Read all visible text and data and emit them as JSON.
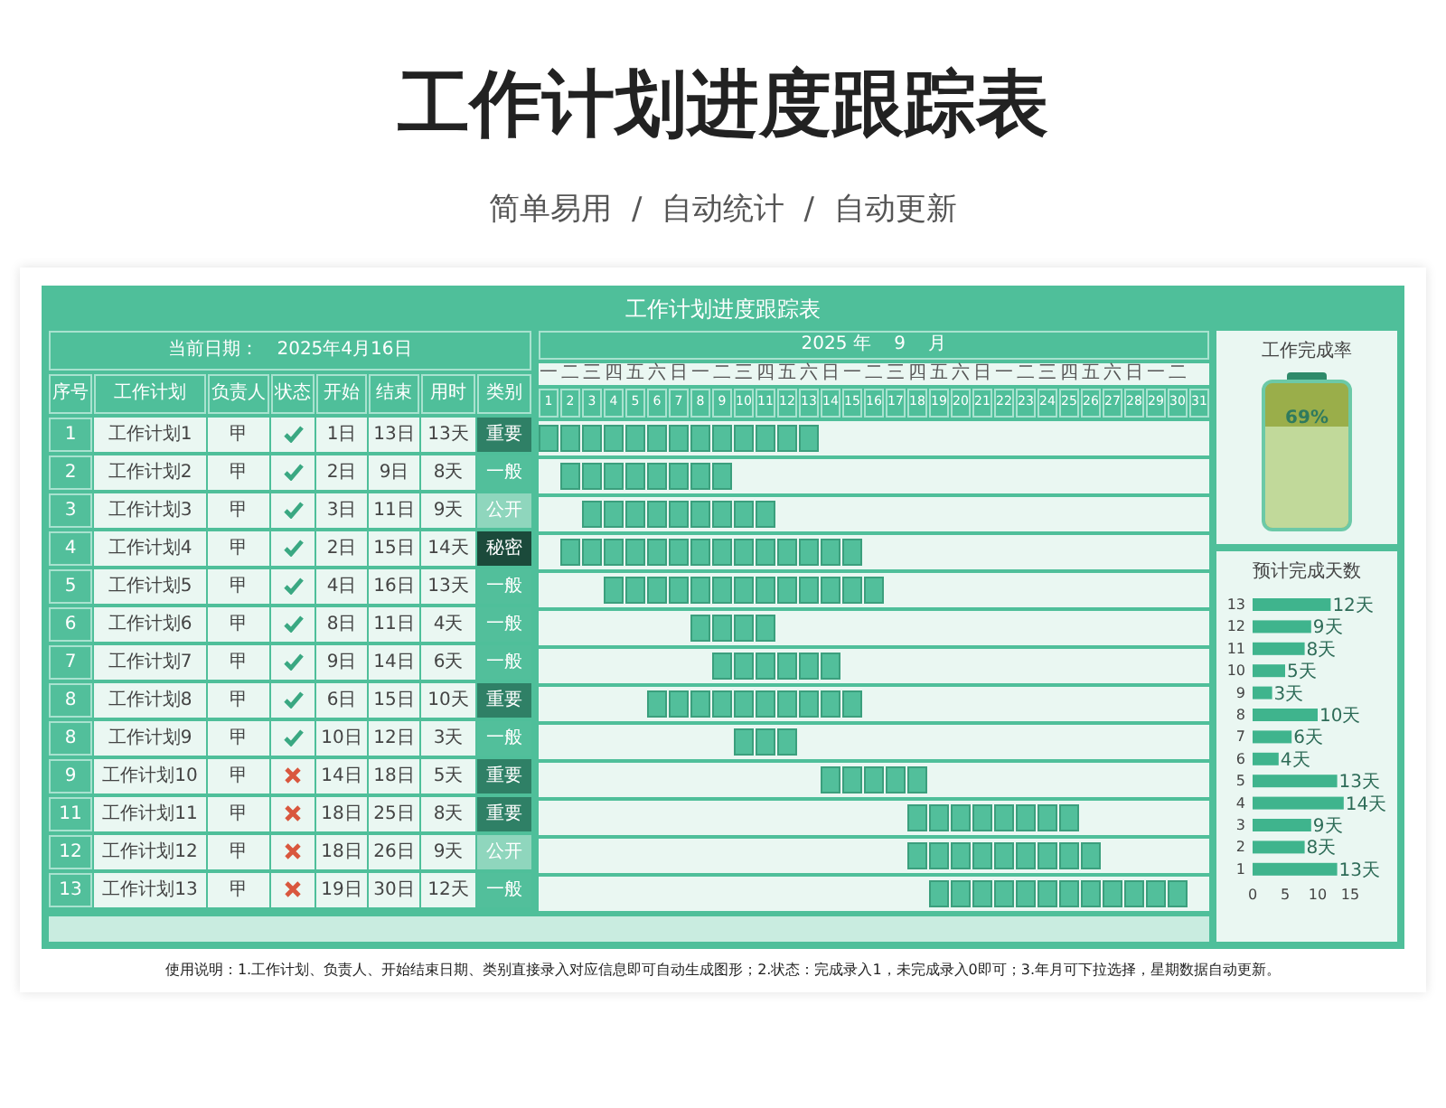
{
  "title": "工作计划进度跟踪表",
  "subtitle": "简单易用  /  自动统计  /  自动更新",
  "sheet": {
    "title": "工作计划进度跟踪表",
    "date_label": "当前日期：",
    "date_value": "2025年4月16日",
    "columns": [
      "序号",
      "工作计划",
      "负责人",
      "状态",
      "开始",
      "结束",
      "用时",
      "类别"
    ],
    "rows": [
      {
        "no": "1",
        "plan": "工作计划1",
        "owner": "甲",
        "done": true,
        "start": "1日",
        "end": "13日",
        "days": "13天",
        "category": "重要",
        "color": "#2f8066"
      },
      {
        "no": "2",
        "plan": "工作计划2",
        "owner": "甲",
        "done": true,
        "start": "2日",
        "end": "9日",
        "days": "8天",
        "category": "一般",
        "color": "#52bf9b"
      },
      {
        "no": "3",
        "plan": "工作计划3",
        "owner": "甲",
        "done": true,
        "start": "3日",
        "end": "11日",
        "days": "9天",
        "category": "公开",
        "color": "#8fd6bd"
      },
      {
        "no": "4",
        "plan": "工作计划4",
        "owner": "甲",
        "done": true,
        "start": "2日",
        "end": "15日",
        "days": "14天",
        "category": "秘密",
        "color": "#1b4a3b"
      },
      {
        "no": "5",
        "plan": "工作计划5",
        "owner": "甲",
        "done": true,
        "start": "4日",
        "end": "16日",
        "days": "13天",
        "category": "一般",
        "color": "#52bf9b"
      },
      {
        "no": "6",
        "plan": "工作计划6",
        "owner": "甲",
        "done": true,
        "start": "8日",
        "end": "11日",
        "days": "4天",
        "category": "一般",
        "color": "#52bf9b"
      },
      {
        "no": "7",
        "plan": "工作计划7",
        "owner": "甲",
        "done": true,
        "start": "9日",
        "end": "14日",
        "days": "6天",
        "category": "一般",
        "color": "#52bf9b"
      },
      {
        "no": "8",
        "plan": "工作计划8",
        "owner": "甲",
        "done": true,
        "start": "6日",
        "end": "15日",
        "days": "10天",
        "category": "重要",
        "color": "#2f8066"
      },
      {
        "no": "8",
        "plan": "工作计划9",
        "owner": "甲",
        "done": true,
        "start": "10日",
        "end": "12日",
        "days": "3天",
        "category": "一般",
        "color": "#52bf9b"
      },
      {
        "no": "9",
        "plan": "工作计划10",
        "owner": "甲",
        "done": false,
        "start": "14日",
        "end": "18日",
        "days": "5天",
        "category": "重要",
        "color": "#2f8066"
      },
      {
        "no": "11",
        "plan": "工作计划11",
        "owner": "甲",
        "done": false,
        "start": "18日",
        "end": "25日",
        "days": "8天",
        "category": "重要",
        "color": "#2f8066"
      },
      {
        "no": "12",
        "plan": "工作计划12",
        "owner": "甲",
        "done": false,
        "start": "18日",
        "end": "26日",
        "days": "9天",
        "category": "公开",
        "color": "#8fd6bd"
      },
      {
        "no": "13",
        "plan": "工作计划13",
        "owner": "甲",
        "done": false,
        "start": "19日",
        "end": "30日",
        "days": "12天",
        "category": "一般",
        "color": "#52bf9b"
      }
    ],
    "month_title": "2025 年    9    月",
    "calendar": [
      {
        "day": "1",
        "weekday": "一"
      },
      {
        "day": "2",
        "weekday": "二"
      },
      {
        "day": "3",
        "weekday": "三"
      },
      {
        "day": "4",
        "weekday": "四"
      },
      {
        "day": "5",
        "weekday": "五"
      },
      {
        "day": "6",
        "weekday": "六"
      },
      {
        "day": "7",
        "weekday": "日"
      },
      {
        "day": "8",
        "weekday": "一"
      },
      {
        "day": "9",
        "weekday": "二"
      },
      {
        "day": "10",
        "weekday": "三"
      },
      {
        "day": "11",
        "weekday": "四"
      },
      {
        "day": "12",
        "weekday": "五"
      },
      {
        "day": "13",
        "weekday": "六"
      },
      {
        "day": "14",
        "weekday": "日"
      },
      {
        "day": "15",
        "weekday": "一"
      },
      {
        "day": "16",
        "weekday": "二"
      },
      {
        "day": "17",
        "weekday": "三"
      },
      {
        "day": "18",
        "weekday": "四"
      },
      {
        "day": "19",
        "weekday": "五"
      },
      {
        "day": "20",
        "weekday": "六"
      },
      {
        "day": "21",
        "weekday": "日"
      },
      {
        "day": "22",
        "weekday": "一"
      },
      {
        "day": "23",
        "weekday": "二"
      },
      {
        "day": "24",
        "weekday": "三"
      },
      {
        "day": "25",
        "weekday": "四"
      },
      {
        "day": "26",
        "weekday": "五"
      },
      {
        "day": "27",
        "weekday": "六"
      },
      {
        "day": "28",
        "weekday": "日"
      },
      {
        "day": "29",
        "weekday": "一"
      },
      {
        "day": "30",
        "weekday": "二"
      },
      {
        "day": "31"
      }
    ],
    "completion": {
      "title": "工作完成率",
      "level": 0.69,
      "reading": "69%"
    },
    "days_chart": {
      "chart_data": {
        "type": "bar",
        "orientation": "horizontal",
        "title": "预计完成天数",
        "categories": [
          "13",
          "12",
          "11",
          "10",
          "9",
          "8",
          "7",
          "6",
          "5",
          "4",
          "3",
          "2",
          "1"
        ],
        "values": [
          12,
          9,
          8,
          5,
          3,
          10,
          6,
          4,
          13,
          14,
          9,
          8,
          13
        ],
        "xlim": [
          0,
          15
        ],
        "xticks": [
          0,
          5,
          10,
          15
        ],
        "value_labels": [
          "12天",
          "9天",
          "8天",
          "5天",
          "3天",
          "10天",
          "6天",
          "4天",
          "13天",
          "14天",
          "9天",
          "8天",
          "13天"
        ]
      }
    }
  },
  "footer": "使用说明：1.工作计划、负责人、开始结束日期、类别直接录入对应信息即可自动生成图形；2.状态：完成录入1，未完成录入0即可；3.年月可下拉选择，星期数据自动更新。"
}
